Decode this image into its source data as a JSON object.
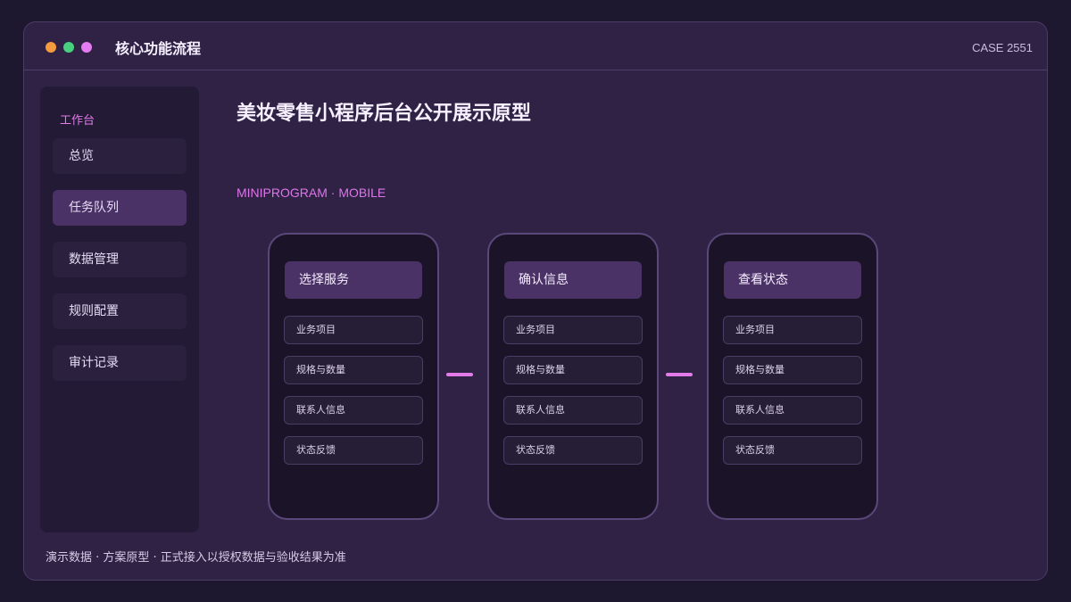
{
  "window": {
    "title": "核心功能流程",
    "case": "CASE 2551"
  },
  "sidebar": {
    "heading": "工作台",
    "items": [
      {
        "label": "总览"
      },
      {
        "label": "任务队列"
      },
      {
        "label": "数据管理"
      },
      {
        "label": "规则配置"
      },
      {
        "label": "审计记录"
      }
    ]
  },
  "main": {
    "heading": "美妆零售小程序后台公开展示原型",
    "subhead": "MINIPROGRAM · MOBILE",
    "phones": [
      {
        "title": "选择服务",
        "items": [
          "业务项目",
          "规格与数量",
          "联系人信息",
          "状态反馈"
        ]
      },
      {
        "title": "确认信息",
        "items": [
          "业务项目",
          "规格与数量",
          "联系人信息",
          "状态反馈"
        ]
      },
      {
        "title": "查看状态",
        "items": [
          "业务项目",
          "规格与数量",
          "联系人信息",
          "状态反馈"
        ]
      }
    ]
  },
  "footer": {
    "note": "演示数据 · 方案原型 · 正式接入以授权数据与验收结果为准"
  },
  "colors": {
    "background": "#1e1730",
    "window": "#2f2245",
    "accent": "#e27ae8",
    "active": "#4a3266"
  }
}
